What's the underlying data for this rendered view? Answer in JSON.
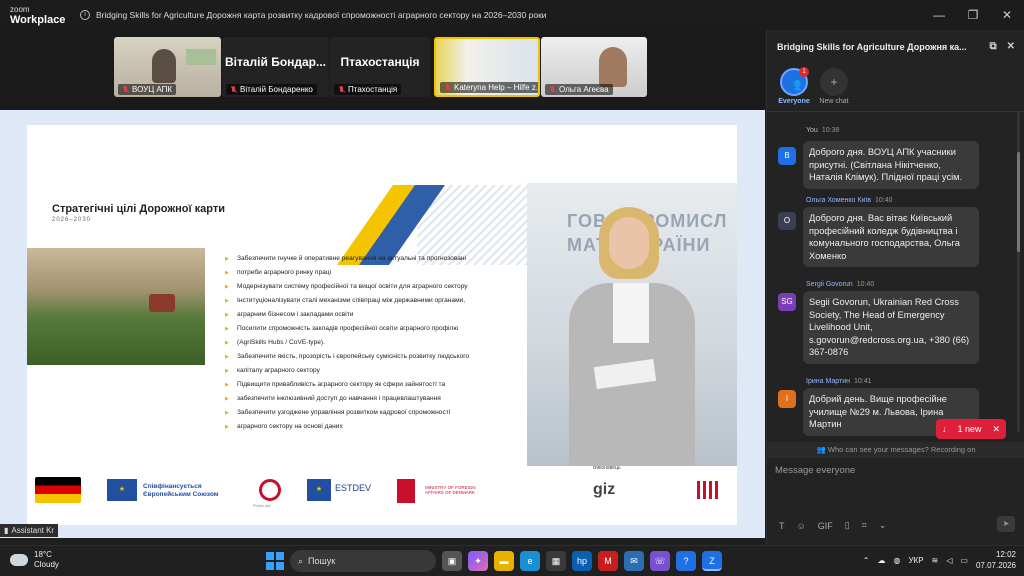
{
  "titlebar": {
    "logo_line1": "zoom",
    "logo_line2": "Workplace",
    "meeting_title": "Bridging Skills for Agriculture  Дорожня карта розвитку кадрової спроможності аграрного сектору на 2026–2030 роки",
    "minimize": "—",
    "restore": "❐",
    "close": "✕"
  },
  "participants": [
    {
      "name": "ВОУЦ АПК",
      "big_label": ""
    },
    {
      "name": "Віталій Бондаренко",
      "big_label": "Віталій Бондар..."
    },
    {
      "name": "Птахостанція",
      "big_label": "Птахостанція"
    },
    {
      "name": "Kateryna Help – Hilfe z...",
      "big_label": ""
    },
    {
      "name": "Ольга Агеєва",
      "big_label": ""
    }
  ],
  "slide": {
    "title": "Стратегічні цілі Дорожної карти",
    "years": "2026–2030",
    "bullets": [
      "Забезпечити гнучке й оперативне реагування на актуальні та прогнозовані",
      "потреби аграрного ринку праці",
      "Модернізувати систему професійної та вищої освіти для аграрного сектору",
      "Інституціоналізувати сталі механізми співпраці між державними органами,",
      "аграрним бізнесом і закладами освіти",
      "Посилити спроможність закладів професійної освіти аграрного профілю",
      "(AgriSkills Hubs / CoVE-type).",
      "Забезпечити якість, прозорість і європейську сумісність розвитку людського",
      "капіталу аграрного сектору",
      "Підвищити привабливість аграрного сектору як сфери зайнятості та",
      "забезпечити інклюзивний доступ до навчання і працевлаштування",
      "Забезпечити узгоджене управління розвитком кадрової спроможності",
      "аграрного сектору на основі даних"
    ],
    "eu_text_1": "Співфінансується",
    "eu_text_2": "Європейським Союзом",
    "estdev": "ESTDEV",
    "polish_aid": "Polish aid",
    "ministry": "MINISTRY OF FOREIGN AFFAIRS OF DENMARK",
    "implementer": "Виконавець",
    "giz": "giz",
    "speaker_bg_1": "ГОВО-ПРОМИСЛ",
    "speaker_bg_2": "МАТА УКРАЇНИ"
  },
  "assistant_badge": "Assistant Kr",
  "chat": {
    "header_title": "Bridging Skills for Agriculture  Дорожня ка...",
    "tabs": [
      {
        "label": "Everyone",
        "badge": "1"
      },
      {
        "label": "New chat"
      }
    ],
    "messages": [
      {
        "sender": "You",
        "time": "10:38",
        "avatar": "B",
        "text": "Доброго дня. ВОУЦ АПК учасники присутні. (Світлана Нікітченко, Наталія Клімук). Плідної праці усім."
      },
      {
        "sender": "Ольга Хоменко Київ",
        "time": "10:40",
        "avatar": "O",
        "text": "Доброго дня. Вас вітає Київський професійний коледж будівництва і комунального господарства, Ольга Хоменко"
      },
      {
        "sender": "Sergii Govorun",
        "time": "10:40",
        "avatar": "SG",
        "text": "Segii Govorun, Ukrainian Red Cross Society, The Head of Emergency Livelihood Unit, s.govorun@redcross.org.ua, +380 (66) 367-0876"
      },
      {
        "sender": "Ірина Мартин",
        "time": "10:41",
        "avatar": "I",
        "text": "Добрий день. Вище професійне училище №29 м. Львова, Ірина Мартин"
      }
    ],
    "new_pill": "1 new",
    "notice": "Who can see your messages? Recording on",
    "compose_placeholder": "Message everyone",
    "colors": {
      "accent": "#1f6fe5",
      "you_avatar": "#1f6fe5",
      "olga_avatar": "#3b3f52",
      "sg_avatar": "#7a3fb8",
      "iryna_avatar": "#e0701c"
    }
  },
  "taskbar": {
    "temp": "18°C",
    "weather": "Cloudy",
    "search_placeholder": "Пошук",
    "lang": "УКР",
    "time": "12:02",
    "date": "07.07.2026"
  }
}
